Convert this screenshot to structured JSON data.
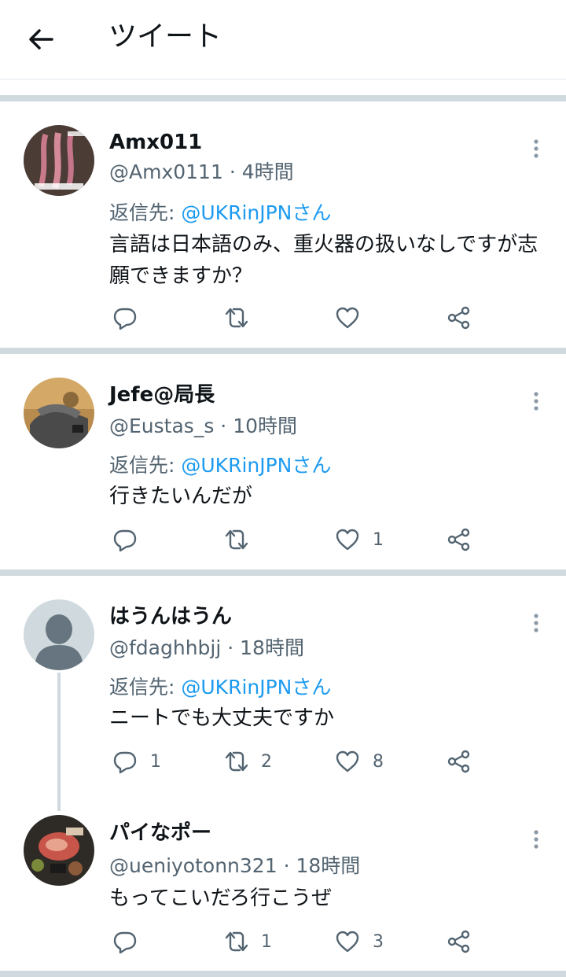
{
  "header": {
    "title": "ツイート"
  },
  "colors": {
    "accent": "#1d9bf0",
    "muted": "#536471",
    "separator": "#cfd9de"
  },
  "tweets": [
    {
      "name": "Amx011",
      "handle": "@Amx0111",
      "time": "4時間",
      "reply_prefix": "返信先: ",
      "reply_to": "@UKRinJPNさん",
      "text": "言語は日本語のみ、重火器の扱いなしですが志願できますか？",
      "replies": "",
      "retweets": "",
      "likes": ""
    },
    {
      "name": "Jefe@局長",
      "handle": "@Eustas_s",
      "time": "10時間",
      "reply_prefix": "返信先: ",
      "reply_to": "@UKRinJPNさん",
      "text": "行きたいんだが",
      "replies": "",
      "retweets": "",
      "likes": "1"
    },
    {
      "name": "はうんはうん",
      "handle": "@fdaghhbjj",
      "time": "18時間",
      "reply_prefix": "返信先: ",
      "reply_to": "@UKRinJPNさん",
      "text": "ニートでも大丈夫ですか",
      "replies": "1",
      "retweets": "2",
      "likes": "8"
    },
    {
      "name": "パイなポー",
      "handle": "@ueniyotonn321",
      "time": "18時間",
      "text": "もってこいだろ行こうぜ",
      "replies": "",
      "retweets": "1",
      "likes": "3"
    }
  ]
}
